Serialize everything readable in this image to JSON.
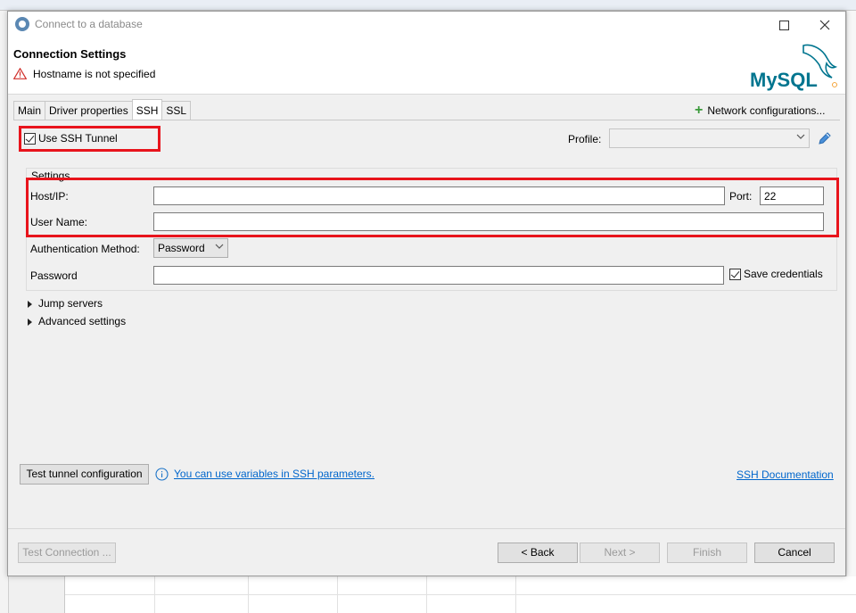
{
  "window": {
    "title": "Connect to a database"
  },
  "header": {
    "title": "Connection Settings",
    "error_message": "Hostname is not specified",
    "logo_text": "MySQL"
  },
  "tabs": [
    {
      "label": "Main",
      "active": false
    },
    {
      "label": "Driver properties",
      "active": false
    },
    {
      "label": "SSH",
      "active": true
    },
    {
      "label": "SSL",
      "active": false
    }
  ],
  "toolbar": {
    "network_configurations": "Network configurations..."
  },
  "ssh": {
    "use_ssh_tunnel_label": "Use SSH Tunnel",
    "use_ssh_tunnel_checked": true,
    "profile_label": "Profile:",
    "profile_value": "",
    "settings_group_label": "Settings",
    "host_label": "Host/IP:",
    "host_value": "",
    "port_label": "Port:",
    "port_value": "22",
    "username_label": "User Name:",
    "username_value": "",
    "auth_method_label": "Authentication Method:",
    "auth_method_value": "Password",
    "password_label": "Password",
    "password_value": "",
    "save_credentials_label": "Save credentials",
    "save_credentials_checked": true,
    "jump_servers_label": "Jump servers",
    "advanced_settings_label": "Advanced settings",
    "test_tunnel_button": "Test tunnel configuration",
    "variables_hint": "You can use variables in SSH parameters.",
    "ssh_documentation_link": "SSH Documentation"
  },
  "footer": {
    "test_connection": "Test Connection ...",
    "back": "< Back",
    "next": "Next >",
    "finish": "Finish",
    "cancel": "Cancel"
  },
  "colors": {
    "highlight_box": "#e8141c",
    "link": "#0066cc",
    "mysql_blue": "#00758f",
    "mysql_orange": "#f29111"
  }
}
